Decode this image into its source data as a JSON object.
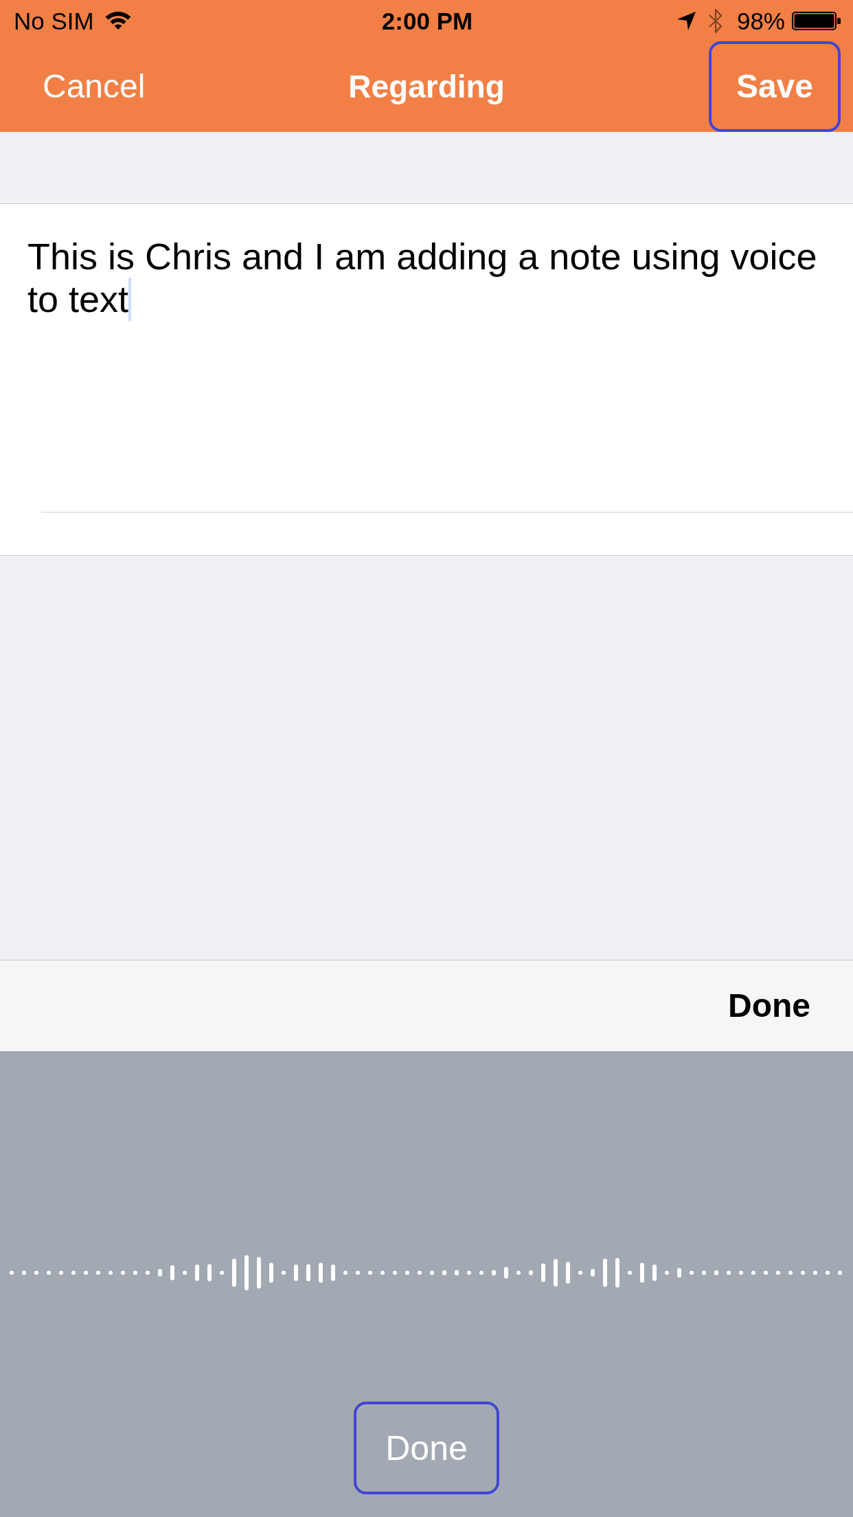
{
  "status_bar": {
    "carrier": "No SIM",
    "time": "2:00 PM",
    "battery": "98%"
  },
  "nav_bar": {
    "left_button": {
      "label": "Cancel",
      "highlighted": false
    },
    "title": "Regarding",
    "right_button": {
      "label": "Save",
      "highlighted": true
    }
  },
  "note": {
    "value": "This is Chris and I am adding a note using voice to text",
    "focused": true
  },
  "keyboard_toolbar": {
    "done_button": {
      "label": "Done"
    }
  },
  "dictation": {
    "done_button": {
      "label": "Done",
      "highlighted": true
    }
  }
}
